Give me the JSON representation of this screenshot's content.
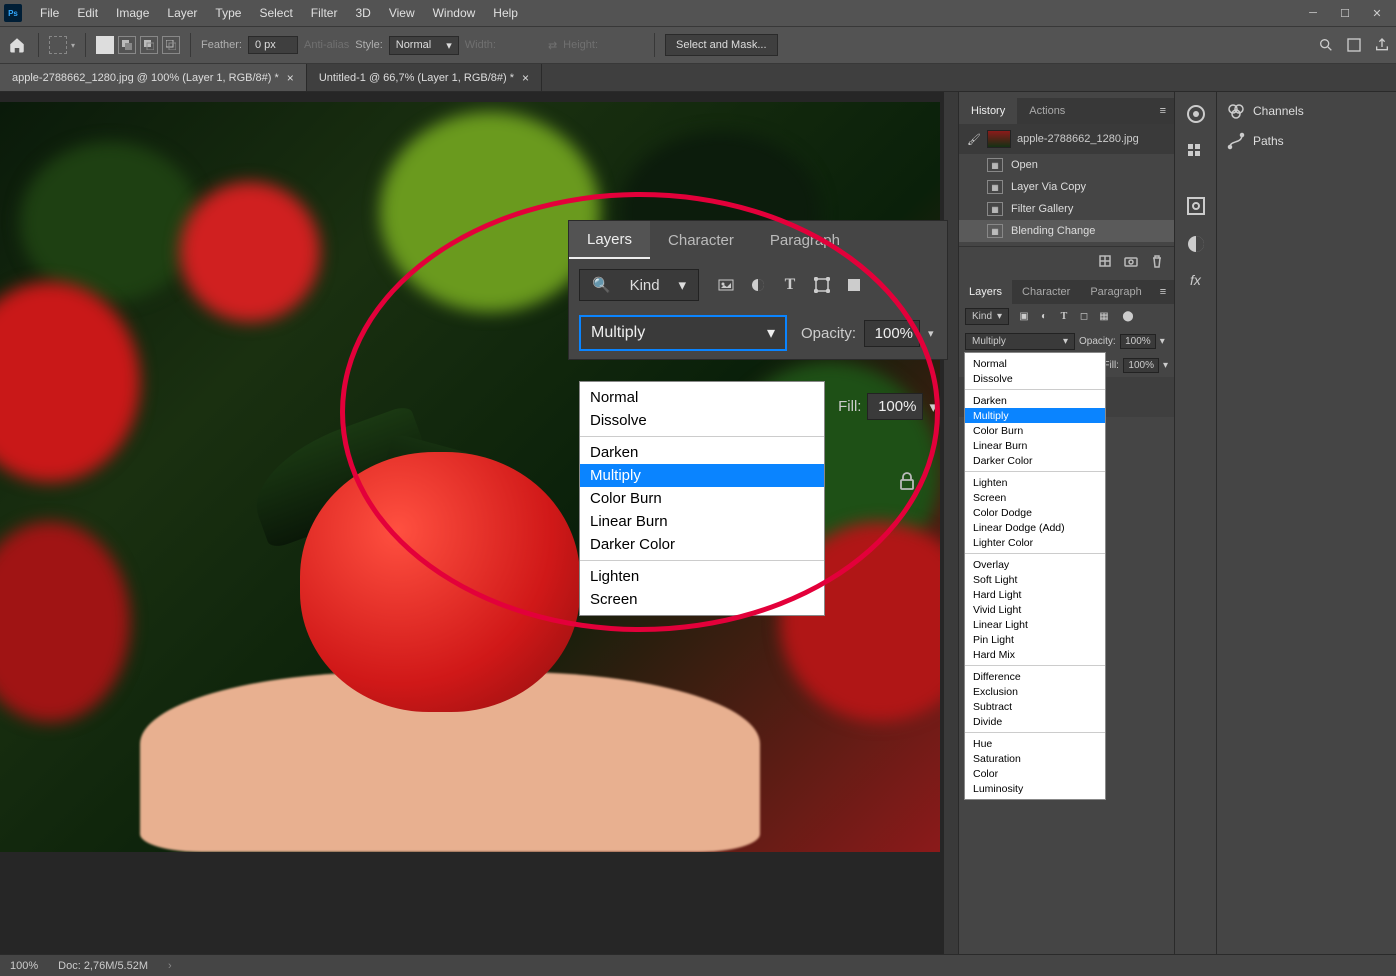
{
  "menu": [
    "File",
    "Edit",
    "Image",
    "Layer",
    "Type",
    "Select",
    "Filter",
    "3D",
    "View",
    "Window",
    "Help"
  ],
  "options": {
    "feather_label": "Feather:",
    "feather_value": "0 px",
    "antialias": "Anti-alias",
    "style_label": "Style:",
    "style_value": "Normal",
    "width_label": "Width:",
    "height_label": "Height:",
    "select_mask": "Select and Mask..."
  },
  "tabs": [
    "apple-2788662_1280.jpg @ 100% (Layer 1, RGB/8#) *",
    "Untitled-1 @ 66,7% (Layer 1, RGB/8#) *"
  ],
  "zoom_panel": {
    "tabs": [
      "Layers",
      "Character",
      "Paragraph"
    ],
    "kind": "Kind",
    "blend": "Multiply",
    "opacity_label": "Opacity:",
    "opacity_value": "100%",
    "fill_label": "Fill:",
    "fill_value": "100%",
    "dropdown_groups": [
      [
        "Normal",
        "Dissolve"
      ],
      [
        "Darken",
        "Multiply",
        "Color Burn",
        "Linear Burn",
        "Darker Color"
      ],
      [
        "Lighten",
        "Screen"
      ]
    ],
    "selected": "Multiply"
  },
  "history": {
    "tabs": [
      "History",
      "Actions"
    ],
    "source": "apple-2788662_1280.jpg",
    "items": [
      "Open",
      "Layer Via Copy",
      "Filter Gallery",
      "Blending Change"
    ],
    "selected": "Blending Change"
  },
  "layers_panel": {
    "tabs": [
      "Layers",
      "Character",
      "Paragraph"
    ],
    "kind": "Kind",
    "blend": "Multiply",
    "opacity_label": "Opacity:",
    "opacity_value": "100%",
    "fill_label": "Fill:",
    "fill_value": "100%"
  },
  "blend_modes": {
    "top": [
      "Normal",
      "Dissolve"
    ],
    "darken": [
      "Darken",
      "Multiply",
      "Color Burn",
      "Linear Burn",
      "Darker Color"
    ],
    "lighten": [
      "Lighten",
      "Screen",
      "Color Dodge",
      "Linear Dodge (Add)",
      "Lighter Color"
    ],
    "contrast": [
      "Overlay",
      "Soft Light",
      "Hard Light",
      "Vivid Light",
      "Linear Light",
      "Pin Light",
      "Hard Mix"
    ],
    "diff": [
      "Difference",
      "Exclusion",
      "Subtract",
      "Divide"
    ],
    "comp": [
      "Hue",
      "Saturation",
      "Color",
      "Luminosity"
    ],
    "selected": "Multiply"
  },
  "far_panels": [
    {
      "icon": "channels",
      "label": "Channels"
    },
    {
      "icon": "paths",
      "label": "Paths"
    }
  ],
  "status": {
    "zoom": "100%",
    "doc": "Doc: 2,76M/5.52M"
  }
}
